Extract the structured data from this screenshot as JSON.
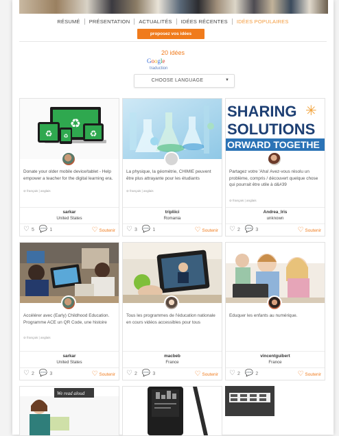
{
  "nav": {
    "items": [
      "RÉSUMÉ",
      "PRÉSENTATION",
      "ACTUALITÉS",
      "IDÉES RÉCENTES",
      "IDÉES POPULAIRES"
    ],
    "active_index": 4
  },
  "propose_button": "proposez vos idées",
  "ideas_count": "20 idées",
  "translate": {
    "google_letters": [
      "G",
      "o",
      "o",
      "g",
      "l",
      "e"
    ],
    "google_colors": [
      "#3b6fd8",
      "#d9442f",
      "#f2b31b",
      "#3b6fd8",
      "#1aa260",
      "#d9442f"
    ],
    "label": "traduction",
    "select_value": "CHOOSE LANGUAGE"
  },
  "accent_color": "#f07b1c",
  "cards": [
    {
      "image_text": "",
      "desc": "Donate your older mobile device/tablet - Help empower a teacher for the digital learning era.",
      "translate_note": "",
      "user": "sarkar",
      "country": "United States",
      "likes": "5",
      "comments": "1",
      "support": "Soutenir"
    },
    {
      "image_text": "",
      "desc": "La physique, la géométrie, CHIMIE peuvent être plus attrayante pour les étudiants",
      "translate_note": "français | anglais",
      "user": "tripliici",
      "country": "Romania",
      "likes": "3",
      "comments": "1",
      "support": "Soutenir"
    },
    {
      "image_text": "SHARING SOLUTIONS ORWARD TOGETHE",
      "image_lines": [
        "SHARING",
        "SOLUTIONS",
        "ORWARD TOGETHE"
      ],
      "desc": "Partagez votre 'Aha! Avez-vous résolu un problème, compris / découvert quelque chose qui pourrait être utile à d&#39",
      "translate_note": "français | anglais",
      "user": "Andrea_Iris",
      "country": "unknown",
      "likes": "2",
      "comments": "3",
      "support": "Soutenir"
    },
    {
      "image_text": "",
      "desc": "Accélérer avec (Early) Childhood Education. Programme ACE un QR Code, une histoire",
      "translate_note": "français | anglais",
      "user": "sarkar",
      "country": "United States",
      "likes": "2",
      "comments": "3",
      "support": "Soutenir"
    },
    {
      "image_text": "",
      "desc": "Tous les programmes de l'éducation nationale en cours vidéos accessibles pour tous",
      "translate_note": "",
      "user": "macbeb",
      "country": "France",
      "likes": "2",
      "comments": "3",
      "support": "Soutenir"
    },
    {
      "image_text": "",
      "desc": "Eduquer les enfants au numérique.",
      "translate_note": "",
      "user": "vincentguibert",
      "country": "France",
      "likes": "2",
      "comments": "2",
      "support": "Soutenir"
    }
  ],
  "partial_cards": {
    "first_image_text": "We read aloud"
  }
}
